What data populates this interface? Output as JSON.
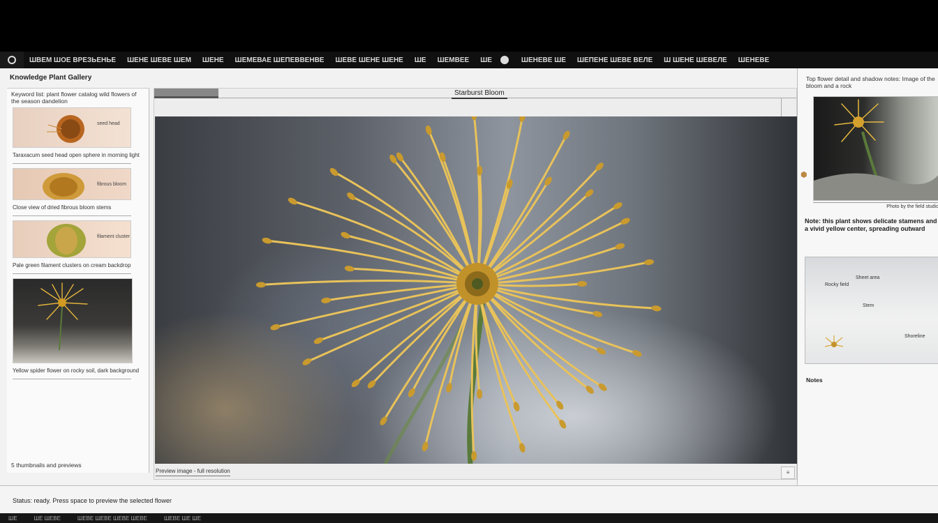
{
  "menubar": {
    "items": [
      "ШВЕМ ШОЕ ВРЕЗЬЕНЬЕ",
      "ШЕНЕ ШЕВЕ ШЕМ",
      "ШЕНЕ",
      "ШЕМЕВАЕ ШЕПЕВВЕНВЕ",
      "ШЕВЕ ШЕНЕ ШЕНЕ",
      "ШЕ",
      "ШЕМВЕЕ",
      "ШЕ",
      "ШЕНЕВЕ ШЕ",
      "ШЕПЕНЕ ШЕВЕ ВЕЛЕ",
      "Ш ШЕНЕ ШЕВЕЛЕ",
      "ШЕНЕВЕ"
    ]
  },
  "window": {
    "title": "Knowledge Plant Gallery"
  },
  "left": {
    "header": "Keyword list: plant flower catalog wild flowers of the season dandelion",
    "cards": [
      {
        "caption": "Taraxacum seed head open sphere in morning light",
        "thumb_label": "seed head"
      },
      {
        "caption": "Close view of dried fibrous bloom stems",
        "thumb_label": "fibrous bloom"
      },
      {
        "caption": "Pale green filament clusters on cream backdrop",
        "thumb_label": "filament cluster"
      },
      {
        "caption": "Yellow spider flower on rocky soil, dark background"
      }
    ],
    "footer": "5 thumbnails and previews"
  },
  "center": {
    "title": "Starburst Bloom",
    "footer": "Preview image - full resolution",
    "corner": "≡"
  },
  "right": {
    "header": "Top flower detail and shadow notes: Image of the bloom and a rock",
    "image_caption": "Photo by the field studio",
    "text": "Note: this plant shows delicate stamens and a vivid yellow center, spreading outward",
    "map_labels": {
      "a": "Sheet area",
      "b": "Rocky field",
      "c": "Stem",
      "d": "Shoreline"
    },
    "footer": "Notes"
  },
  "status": {
    "text": "Status: ready. Press space to preview the selected flower"
  },
  "bottombar": {
    "items": [
      "ШЕ",
      "ШЕ ШЕВЕ",
      "ШЕВЕ ШЕВЕ ШЕВЕ ШЕВЕ",
      "ШЕВЕ ШЕ ШЕ"
    ]
  },
  "colors": {
    "petal": "#e8c25a",
    "petal_dark": "#c99a2e",
    "stem": "#5a7a3a"
  }
}
